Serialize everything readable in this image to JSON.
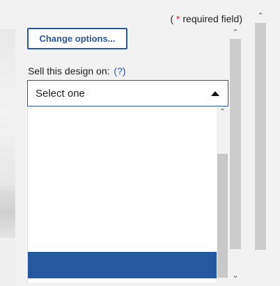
{
  "header": {
    "required_open": "( ",
    "required_star": "*",
    "required_text": " required field)"
  },
  "options": {
    "change_label": "Change options..."
  },
  "sell": {
    "label": "Sell this design on: ",
    "help": "(?)",
    "selected_value": "Select one",
    "highlight_color": "#2658a0"
  },
  "icons": {
    "caret": "caret-up-icon",
    "scroll_up": "chevron-up-icon",
    "scroll_down": "chevron-down-icon"
  },
  "glyphs": {
    "up": "⌃",
    "down": "⌄"
  }
}
